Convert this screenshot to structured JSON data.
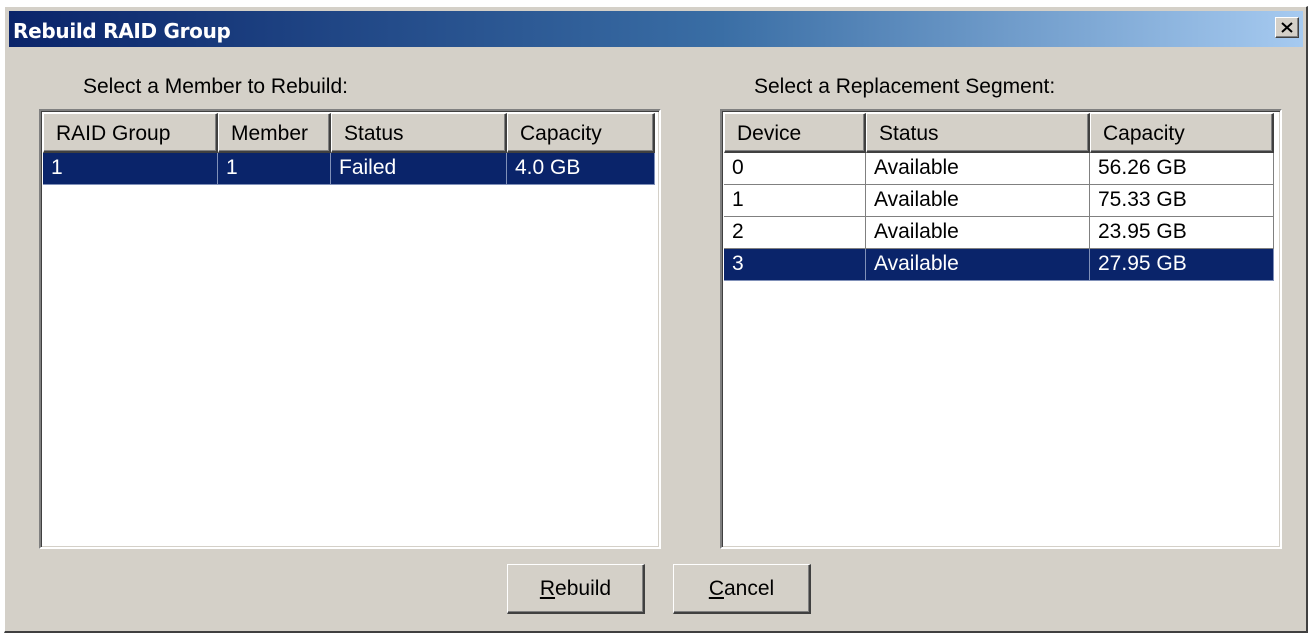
{
  "window": {
    "title": "Rebuild RAID Group"
  },
  "member_panel": {
    "label": "Select a Member to Rebuild:",
    "columns": [
      "RAID Group",
      "Member",
      "Status",
      "Capacity"
    ],
    "rows": [
      {
        "raid_group": "1",
        "member": "1",
        "status": "Failed",
        "capacity": "4.0 GB",
        "selected": true
      }
    ]
  },
  "segment_panel": {
    "label": "Select a Replacement Segment:",
    "columns": [
      "Device",
      "Status",
      "Capacity"
    ],
    "rows": [
      {
        "device": "0",
        "status": "Available",
        "capacity": "56.26 GB",
        "selected": false
      },
      {
        "device": "1",
        "status": "Available",
        "capacity": "75.33 GB",
        "selected": false
      },
      {
        "device": "2",
        "status": "Available",
        "capacity": "23.95 GB",
        "selected": false
      },
      {
        "device": "3",
        "status": "Available",
        "capacity": "27.95 GB",
        "selected": true
      }
    ]
  },
  "buttons": {
    "rebuild": {
      "mnemonic": "R",
      "rest": "ebuild"
    },
    "cancel": {
      "mnemonic": "C",
      "rest": "ancel"
    }
  },
  "colors": {
    "selection": "#0a246a",
    "dialog_face": "#d4d0c8",
    "title_gradient_start": "#0a246a",
    "title_gradient_end": "#a6caf0"
  },
  "icons": {
    "close": "close-icon"
  }
}
